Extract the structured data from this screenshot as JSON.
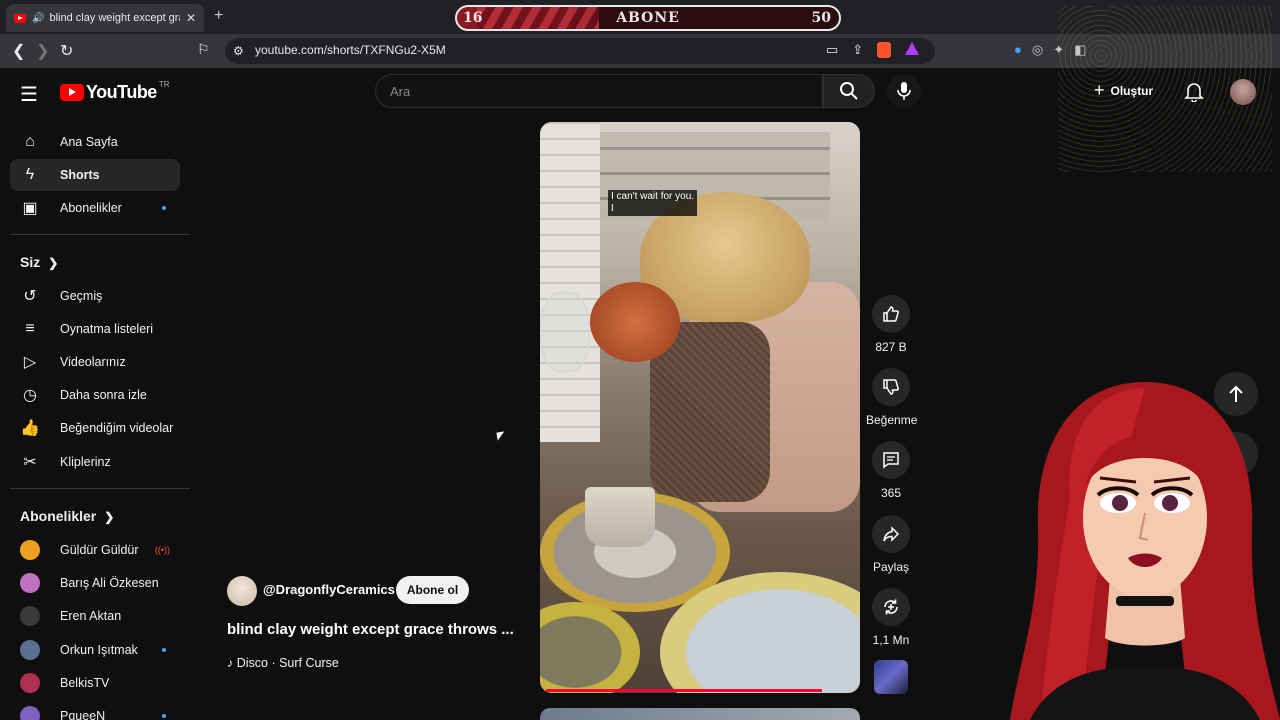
{
  "browser": {
    "tab_title": "blind clay weight except grace",
    "url": "youtube.com/shorts/TXFNGu2-X5M"
  },
  "subscriber_goal": {
    "current": "16",
    "label": "ABONE",
    "goal": "50",
    "progress": 0.32
  },
  "masthead": {
    "logo_text": "YouTube",
    "country_code": "TR",
    "search_placeholder": "Ara",
    "create_label": "Oluştur"
  },
  "sidebar": {
    "main": [
      {
        "label": "Ana Sayfa",
        "icon": "home-icon"
      },
      {
        "label": "Shorts",
        "icon": "shorts-icon",
        "active": true
      },
      {
        "label": "Abonelikler",
        "icon": "subscriptions-icon",
        "new_dot": true
      }
    ],
    "you_heading": "Siz",
    "you": [
      {
        "label": "Geçmiş",
        "icon": "history-icon"
      },
      {
        "label": "Oynatma listeleri",
        "icon": "playlists-icon"
      },
      {
        "label": "Videolarınız",
        "icon": "your-videos-icon"
      },
      {
        "label": "Daha sonra izle",
        "icon": "watch-later-icon"
      },
      {
        "label": "Beğendiğim videolar",
        "icon": "liked-icon"
      },
      {
        "label": "Kliplerinz",
        "icon": "clips-icon"
      }
    ],
    "subs_heading": "Abonelikler",
    "subscriptions": [
      {
        "label": "Güldür Güldür",
        "color": "#f0a020",
        "live": true
      },
      {
        "label": "Barış Ali Özkesen",
        "color": "#c070c0"
      },
      {
        "label": "Eren Aktan",
        "color": "#3a3a3a"
      },
      {
        "label": "Orkun Işıtmak",
        "color": "#5a7090",
        "new_dot": true
      },
      {
        "label": "BelkisTV",
        "color": "#b03050"
      },
      {
        "label": "PqueeN",
        "color": "#8060c0",
        "new_dot": true
      }
    ]
  },
  "video": {
    "caption_line1": "I can't wait for you.",
    "caption_line2": "I",
    "progress": 0.88
  },
  "actions": {
    "like_count": "827 B",
    "dislike_label": "Beğenme",
    "comment_count": "365",
    "share_label": "Paylaş",
    "remix_count": "1,1 Mn"
  },
  "channel": {
    "handle": "@DragonflyCeramics",
    "subscribe_label": "Abone ol",
    "title": "blind clay weight except grace throws ...",
    "music": "Disco · Surf Curse"
  }
}
